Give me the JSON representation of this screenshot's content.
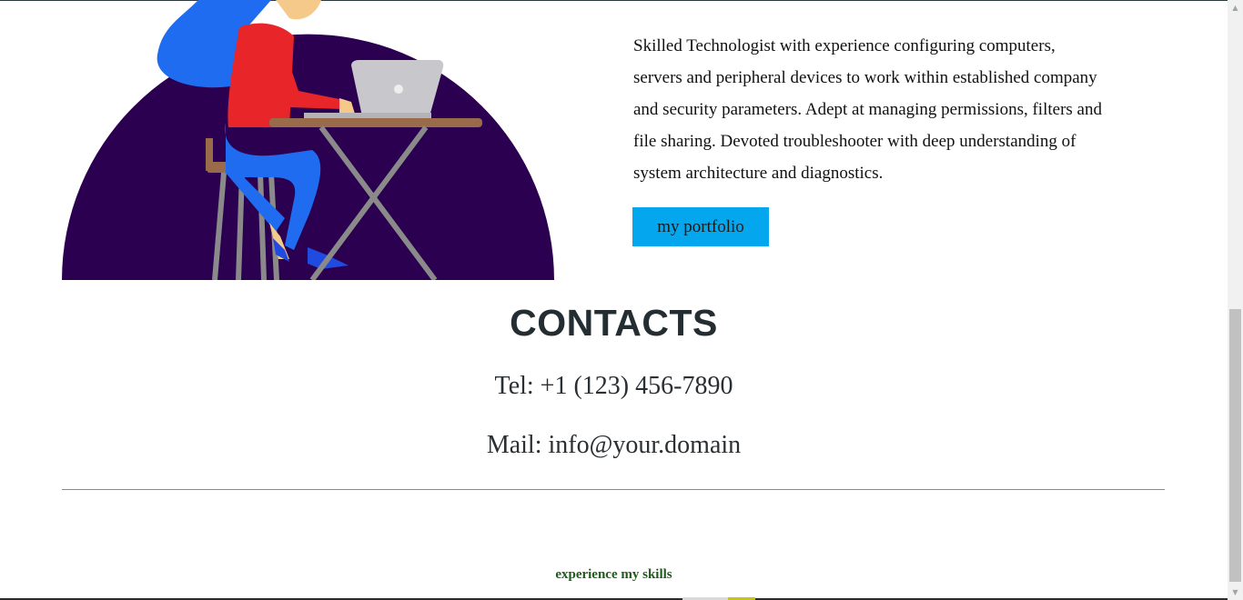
{
  "about": {
    "text": "Skilled Technologist with experience configuring computers, servers and peripheral devices to work within established company and security parameters. Adept at managing permissions, filters and file sharing. Devoted troubleshooter with deep understanding of system architecture and diagnostics.",
    "lines": [
      "Skilled Technologist with experience configuring computers,",
      "servers and peripheral devices to work within established company",
      "and security parameters. Adept at managing permissions, filters and",
      "file sharing. Devoted troubleshooter with deep understanding of",
      "system architecture and diagnostics."
    ],
    "button_label": "my portfolio"
  },
  "contacts": {
    "title": "CONTACTS",
    "tel": "Tel: +1 (123) 456-7890",
    "mail": "Mail: info@your.domain"
  },
  "footer": {
    "link_text": "experience my skills"
  },
  "colors": {
    "accent_button": "#04a6ee",
    "illustration_bg": "#2c0050",
    "footer_link": "#1e5b1a",
    "heading": "#232d32"
  },
  "icons": {
    "scroll_up": "triangle-up-icon",
    "scroll_down": "triangle-down-icon"
  }
}
